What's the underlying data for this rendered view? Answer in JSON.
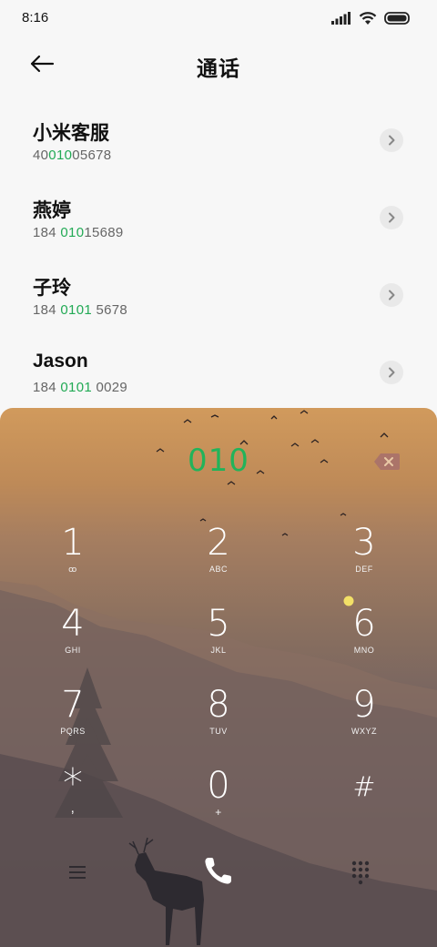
{
  "status_bar": {
    "time": "8:16",
    "icons": [
      "signal-icon",
      "wifi-icon",
      "battery-icon"
    ]
  },
  "header": {
    "title": "通话",
    "back_icon": "back-arrow-icon"
  },
  "contacts": [
    {
      "name": "小米客服",
      "number_pre": "40",
      "number_match": "010",
      "number_post": "05678"
    },
    {
      "name": "燕婷",
      "number_pre": "184 ",
      "number_match": "010",
      "number_post": "15689"
    },
    {
      "name": "子玲",
      "number_pre": "184 ",
      "number_match": "0101",
      "number_post": " 5678"
    },
    {
      "name": "Jason",
      "number_pre": "184 ",
      "number_match": "0101",
      "number_post": " 0029"
    }
  ],
  "dialpad": {
    "input": "010",
    "keys": [
      {
        "digit": "1",
        "letters": "ꝏ"
      },
      {
        "digit": "2",
        "letters": "ABC"
      },
      {
        "digit": "3",
        "letters": "DEF"
      },
      {
        "digit": "4",
        "letters": "GHI"
      },
      {
        "digit": "5",
        "letters": "JKL"
      },
      {
        "digit": "6",
        "letters": "MNO"
      },
      {
        "digit": "7",
        "letters": "PQRS"
      },
      {
        "digit": "8",
        "letters": "TUV"
      },
      {
        "digit": "9",
        "letters": "WXYZ"
      },
      {
        "digit": "*",
        "letters": ","
      },
      {
        "digit": "0",
        "letters": "+"
      },
      {
        "digit": "#",
        "letters": ""
      }
    ]
  },
  "colors": {
    "match_highlight": "#22aa55",
    "dial_input": "#22b35a"
  }
}
